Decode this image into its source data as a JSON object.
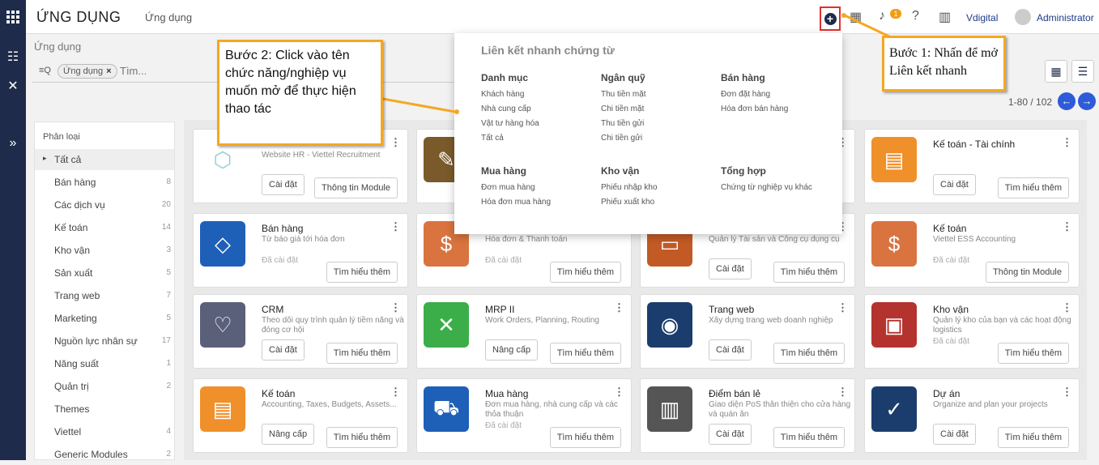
{
  "topbar": {
    "app_title": "ỨNG DỤNG",
    "menu_label": "Ứng dụng",
    "notif_count": "1",
    "company": "Vdigital",
    "user": "Administrator"
  },
  "breadcrumb": "Ứng dụng",
  "search": {
    "facet_label": "Ứng dụng",
    "placeholder": "Tìm..."
  },
  "pager": {
    "range": "1-80 / 102"
  },
  "sidebar": {
    "heading": "Phân loại",
    "items": [
      {
        "label": "Tất cả",
        "count": ""
      },
      {
        "label": "Bán hàng",
        "count": "8"
      },
      {
        "label": "Các dịch vụ",
        "count": "20"
      },
      {
        "label": "Kế toán",
        "count": "14"
      },
      {
        "label": "Kho vận",
        "count": "3"
      },
      {
        "label": "Sản xuất",
        "count": "5"
      },
      {
        "label": "Trang web",
        "count": "7"
      },
      {
        "label": "Marketing",
        "count": "5"
      },
      {
        "label": "Nguồn lực nhân sự",
        "count": "17"
      },
      {
        "label": "Năng suất",
        "count": "1"
      },
      {
        "label": "Quản trị",
        "count": "2"
      },
      {
        "label": "Themes",
        "count": ""
      },
      {
        "label": "Viettel",
        "count": "4"
      },
      {
        "label": "Generic Modules",
        "count": "2"
      }
    ]
  },
  "cards": [
    {
      "title": "",
      "desc": "Website HR - Viettel Recruitment",
      "state": "",
      "btn1": "Cài đặt",
      "btn2": "Thông tin Module",
      "color": "#ffffff",
      "icon": "cube-icon"
    },
    {
      "title": "",
      "desc": "",
      "state": "",
      "btn1": "",
      "btn2": "",
      "color": "#7a5a2a",
      "icon": "tool-icon"
    },
    {
      "title": "",
      "desc": "",
      "state": "",
      "btn1": "",
      "btn2": "",
      "color": "#ffffff",
      "icon": ""
    },
    {
      "title": "Kế toán - Tài chính",
      "desc": "",
      "state": "",
      "btn1": "Cài đặt",
      "btn2": "Tìm hiểu thêm",
      "color": "#f0902a",
      "icon": "document-icon"
    },
    {
      "title": "Bán hàng",
      "desc": "Từ báo giá tới hóa đơn",
      "state": "Đã cài đặt",
      "btn1": "",
      "btn2": "Tìm hiểu thêm",
      "color": "#1e5fb8",
      "icon": "tag-icon"
    },
    {
      "title": "",
      "desc": "Hóa đơn & Thanh toán",
      "state": "Đã cài đặt",
      "btn1": "",
      "btn2": "Tìm hiểu thêm",
      "color": "#d9733f",
      "icon": "invoice-icon"
    },
    {
      "title": "",
      "desc": "Quản lý Tài sản và Công cụ dụng cụ",
      "state": "",
      "btn1": "Cài đặt",
      "btn2": "Tìm hiểu thêm",
      "color": "#c25a26",
      "icon": "wallet-icon"
    },
    {
      "title": "Kế toán",
      "desc": "Viettel ESS Accounting",
      "state": "Đã cài đặt",
      "btn1": "",
      "btn2": "Thông tin Module",
      "color": "#d9733f",
      "icon": "invoice-icon"
    },
    {
      "title": "CRM",
      "desc": "Theo dõi quy trình quản lý tiềm năng và đóng cơ hội",
      "state": "",
      "btn1": "Cài đặt",
      "btn2": "Tìm hiểu thêm",
      "color": "#5a5f7a",
      "icon": "handshake-icon"
    },
    {
      "title": "MRP II",
      "desc": "Work Orders, Planning, Routing",
      "state": "",
      "btn1": "Nâng cấp",
      "btn2": "Tìm hiểu thêm",
      "color": "#3bae4a",
      "icon": "wrench-icon"
    },
    {
      "title": "Trang web",
      "desc": "Xây dựng trang web doanh nghiệp",
      "state": "",
      "btn1": "Cài đặt",
      "btn2": "Tìm hiểu thêm",
      "color": "#1b3d6e",
      "icon": "globe-icon"
    },
    {
      "title": "Kho vận",
      "desc": "Quản lý kho của bạn và các hoạt động logistics",
      "state": "Đã cài đặt",
      "btn1": "",
      "btn2": "Tìm hiểu thêm",
      "color": "#b5332e",
      "icon": "box-icon"
    },
    {
      "title": "Kế toán",
      "desc": "Accounting, Taxes, Budgets, Assets...",
      "state": "",
      "btn1": "Nâng cấp",
      "btn2": "Tìm hiểu thêm",
      "color": "#f0902a",
      "icon": "document-icon"
    },
    {
      "title": "Mua hàng",
      "desc": "Đơn mua hàng, nhà cung cấp và các thỏa thuận",
      "state": "Đã cài đặt",
      "btn1": "",
      "btn2": "Tìm hiểu thêm",
      "color": "#1e5fb8",
      "icon": "cart-icon"
    },
    {
      "title": "Điểm bán lẻ",
      "desc": "Giao diện PoS thân thiện cho cửa hàng và quán ăn",
      "state": "",
      "btn1": "Cài đặt",
      "btn2": "Tìm hiểu thêm",
      "color": "#555555",
      "icon": "store-icon"
    },
    {
      "title": "Dự án",
      "desc": "Organize and plan your projects",
      "state": "",
      "btn1": "Cài đặt",
      "btn2": "Tìm hiểu thêm",
      "color": "#1b3d6e",
      "icon": "check-icon"
    }
  ],
  "quicklinks": {
    "title": "Liên kết nhanh chứng từ",
    "groups": [
      {
        "heading": "Danh mục",
        "links": [
          "Khách hàng",
          "Nhà cung cấp",
          "Vật tư hàng hóa",
          "Tất cả"
        ]
      },
      {
        "heading": "Ngân quỹ",
        "links": [
          "Thu tiền mặt",
          "Chi tiền mặt",
          "Thu tiền gửi",
          "Chi tiền gửi"
        ]
      },
      {
        "heading": "Bán hàng",
        "links": [
          "Đơn đặt hàng",
          "Hóa đơn bán hàng"
        ]
      },
      {
        "heading": "Mua hàng",
        "links": [
          "Đơn mua hàng",
          "Hóa đơn mua hàng"
        ]
      },
      {
        "heading": "Kho vận",
        "links": [
          "Phiếu nhập kho",
          "Phiếu xuất kho"
        ]
      },
      {
        "heading": "Tổng hợp",
        "links": [
          "Chứng từ nghiệp vụ khác"
        ]
      }
    ]
  },
  "callouts": {
    "step1": "Bước 1: Nhấn để mở Liên kết nhanh",
    "step2": "Bước 2: Click vào tên chức năng/nghiệp vụ muốn mở để thực hiện thao tác"
  },
  "colors": {
    "accent": "#f4a822",
    "nav": "#1f2b4a",
    "highlight": "#e0312f",
    "pager": "#2e5bd8"
  }
}
